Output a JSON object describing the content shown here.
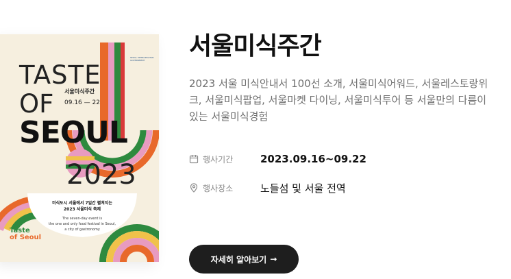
{
  "event": {
    "title": "서울미식주간",
    "description": "2023 서울 미식안내서 100선 소개, 서울미식어워드, 서울레스토랑위크, 서울미식팝업, 서울마켓 다이닝, 서울미식투어 등 서울만의 다름이 있는 서울미식경험",
    "period_label": "행사기간",
    "period_value": "2023.09.16~09.22",
    "place_label": "행사장소",
    "place_value": "노들섬 및 서울 전역",
    "cta_label": "자세히 알아보기",
    "cta_arrow": "→"
  },
  "poster": {
    "line1": "TASTE",
    "line2": "OF",
    "line3": "SEOUL",
    "year": "2023",
    "week_label": "서울미식주간",
    "dates": "09.16 — 22",
    "tagline_ko_1": "미식도시 서울에서 7일간 펼쳐지는",
    "tagline_ko_2": "2023 서울미식 축제",
    "tagline_en_1": "The seven-day event is",
    "tagline_en_2": "the one and only food festival in Seoul,",
    "tagline_en_3": "a city of gastronomy",
    "logo_1": "Taste",
    "logo_2": "of Seoul",
    "org_1": "SEOUL METROPOLITAN",
    "org_2": "GOVERNMENT"
  },
  "colors": {
    "poster_bg": "#f6efdf",
    "stripe_orange": "#e8692b",
    "stripe_pink": "#e89bc0",
    "stripe_green": "#2e8a3f",
    "stripe_red": "#d93a3a",
    "stripe_yellow": "#f0c24a",
    "button_bg": "#1e1e1e"
  },
  "icons": {
    "calendar": "calendar-icon",
    "location": "location-pin-icon",
    "arrow": "arrow-right-icon"
  }
}
